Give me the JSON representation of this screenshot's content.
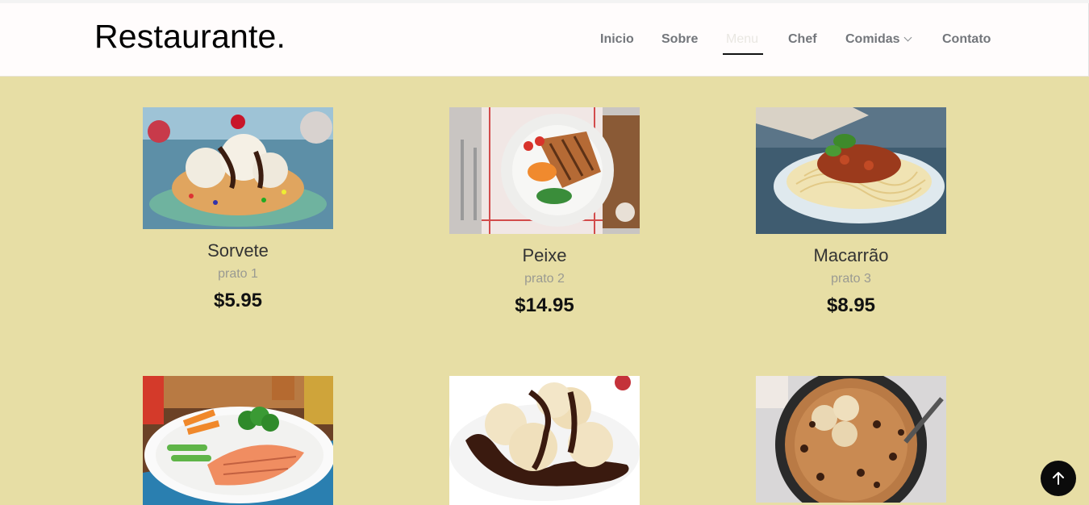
{
  "brand": "Restaurante.",
  "nav": [
    {
      "label": "Inicio"
    },
    {
      "label": "Sobre"
    },
    {
      "label": "Menu",
      "active": true
    },
    {
      "label": "Chef"
    },
    {
      "label": "Comidas",
      "dropdown": true
    },
    {
      "label": "Contato"
    }
  ],
  "menu_items": [
    {
      "title": "Sorvete",
      "subtitle": "prato 1",
      "price": "$5.95",
      "image": "ice-cream-sundae"
    },
    {
      "title": "Peixe",
      "subtitle": "prato 2",
      "price": "$14.95",
      "image": "grilled-fish-plate"
    },
    {
      "title": "Macarrão",
      "subtitle": "prato 3",
      "price": "$8.95",
      "image": "spaghetti-bolognese"
    },
    {
      "title": "",
      "subtitle": "",
      "price": "",
      "image": "salmon-with-vegetables"
    },
    {
      "title": "",
      "subtitle": "",
      "price": "",
      "image": "profiteroles-chocolate"
    },
    {
      "title": "",
      "subtitle": "",
      "price": "",
      "image": "skillet-cookie"
    }
  ],
  "icons": {
    "back_to_top": "arrow-up-icon",
    "dropdown": "chevron-down-icon"
  },
  "colors": {
    "background": "#e7dea5",
    "header": "#fffcfc",
    "nav_text": "#73767b",
    "active_underline": "#111111",
    "price": "#111111"
  }
}
